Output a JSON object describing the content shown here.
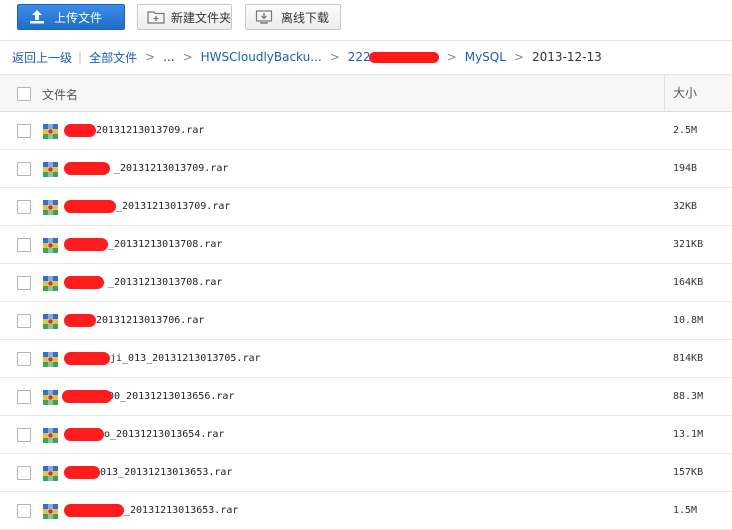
{
  "toolbar": {
    "upload_label": "上传文件",
    "new_folder_label": "新建文件夹",
    "offline_download_label": "离线下载"
  },
  "breadcrumb": {
    "back": "返回上一级",
    "all_files": "全部文件",
    "ellipsis": "...",
    "level1": "HWSCloudlyBacku...",
    "level2": "222",
    "level3": "MySQL",
    "current": "2013-12-13"
  },
  "table": {
    "col_name": "文件名",
    "col_size": "大小"
  },
  "files": [
    {
      "name": "20131213013709.rar",
      "size": "2.5M"
    },
    {
      "name": "_20131213013709.rar",
      "size": "194B"
    },
    {
      "name": "_20131213013709.rar",
      "size": "32KB"
    },
    {
      "name": "_20131213013708.rar",
      "size": "321KB"
    },
    {
      "name": "_20131213013708.rar",
      "size": "164KB"
    },
    {
      "name": "20131213013706.rar",
      "size": "10.8M"
    },
    {
      "name": "ji_013_20131213013705.rar",
      "size": "814KB"
    },
    {
      "name": "00_20131213013656.rar",
      "size": "88.3M"
    },
    {
      "name": "o_20131213013654.rar",
      "size": "13.1M"
    },
    {
      "name": "013_20131213013653.rar",
      "size": "157KB"
    },
    {
      "name": "_20131213013653.rar",
      "size": "1.5M"
    }
  ],
  "colors": {
    "primary_button": "#2a7ad8",
    "link": "#1a5fb4",
    "redaction": "#ff1010"
  },
  "icons": {
    "upload": "upload-arrow-icon",
    "new_folder": "new-folder-icon",
    "offline": "offline-download-icon",
    "file": "rar-archive-icon"
  }
}
